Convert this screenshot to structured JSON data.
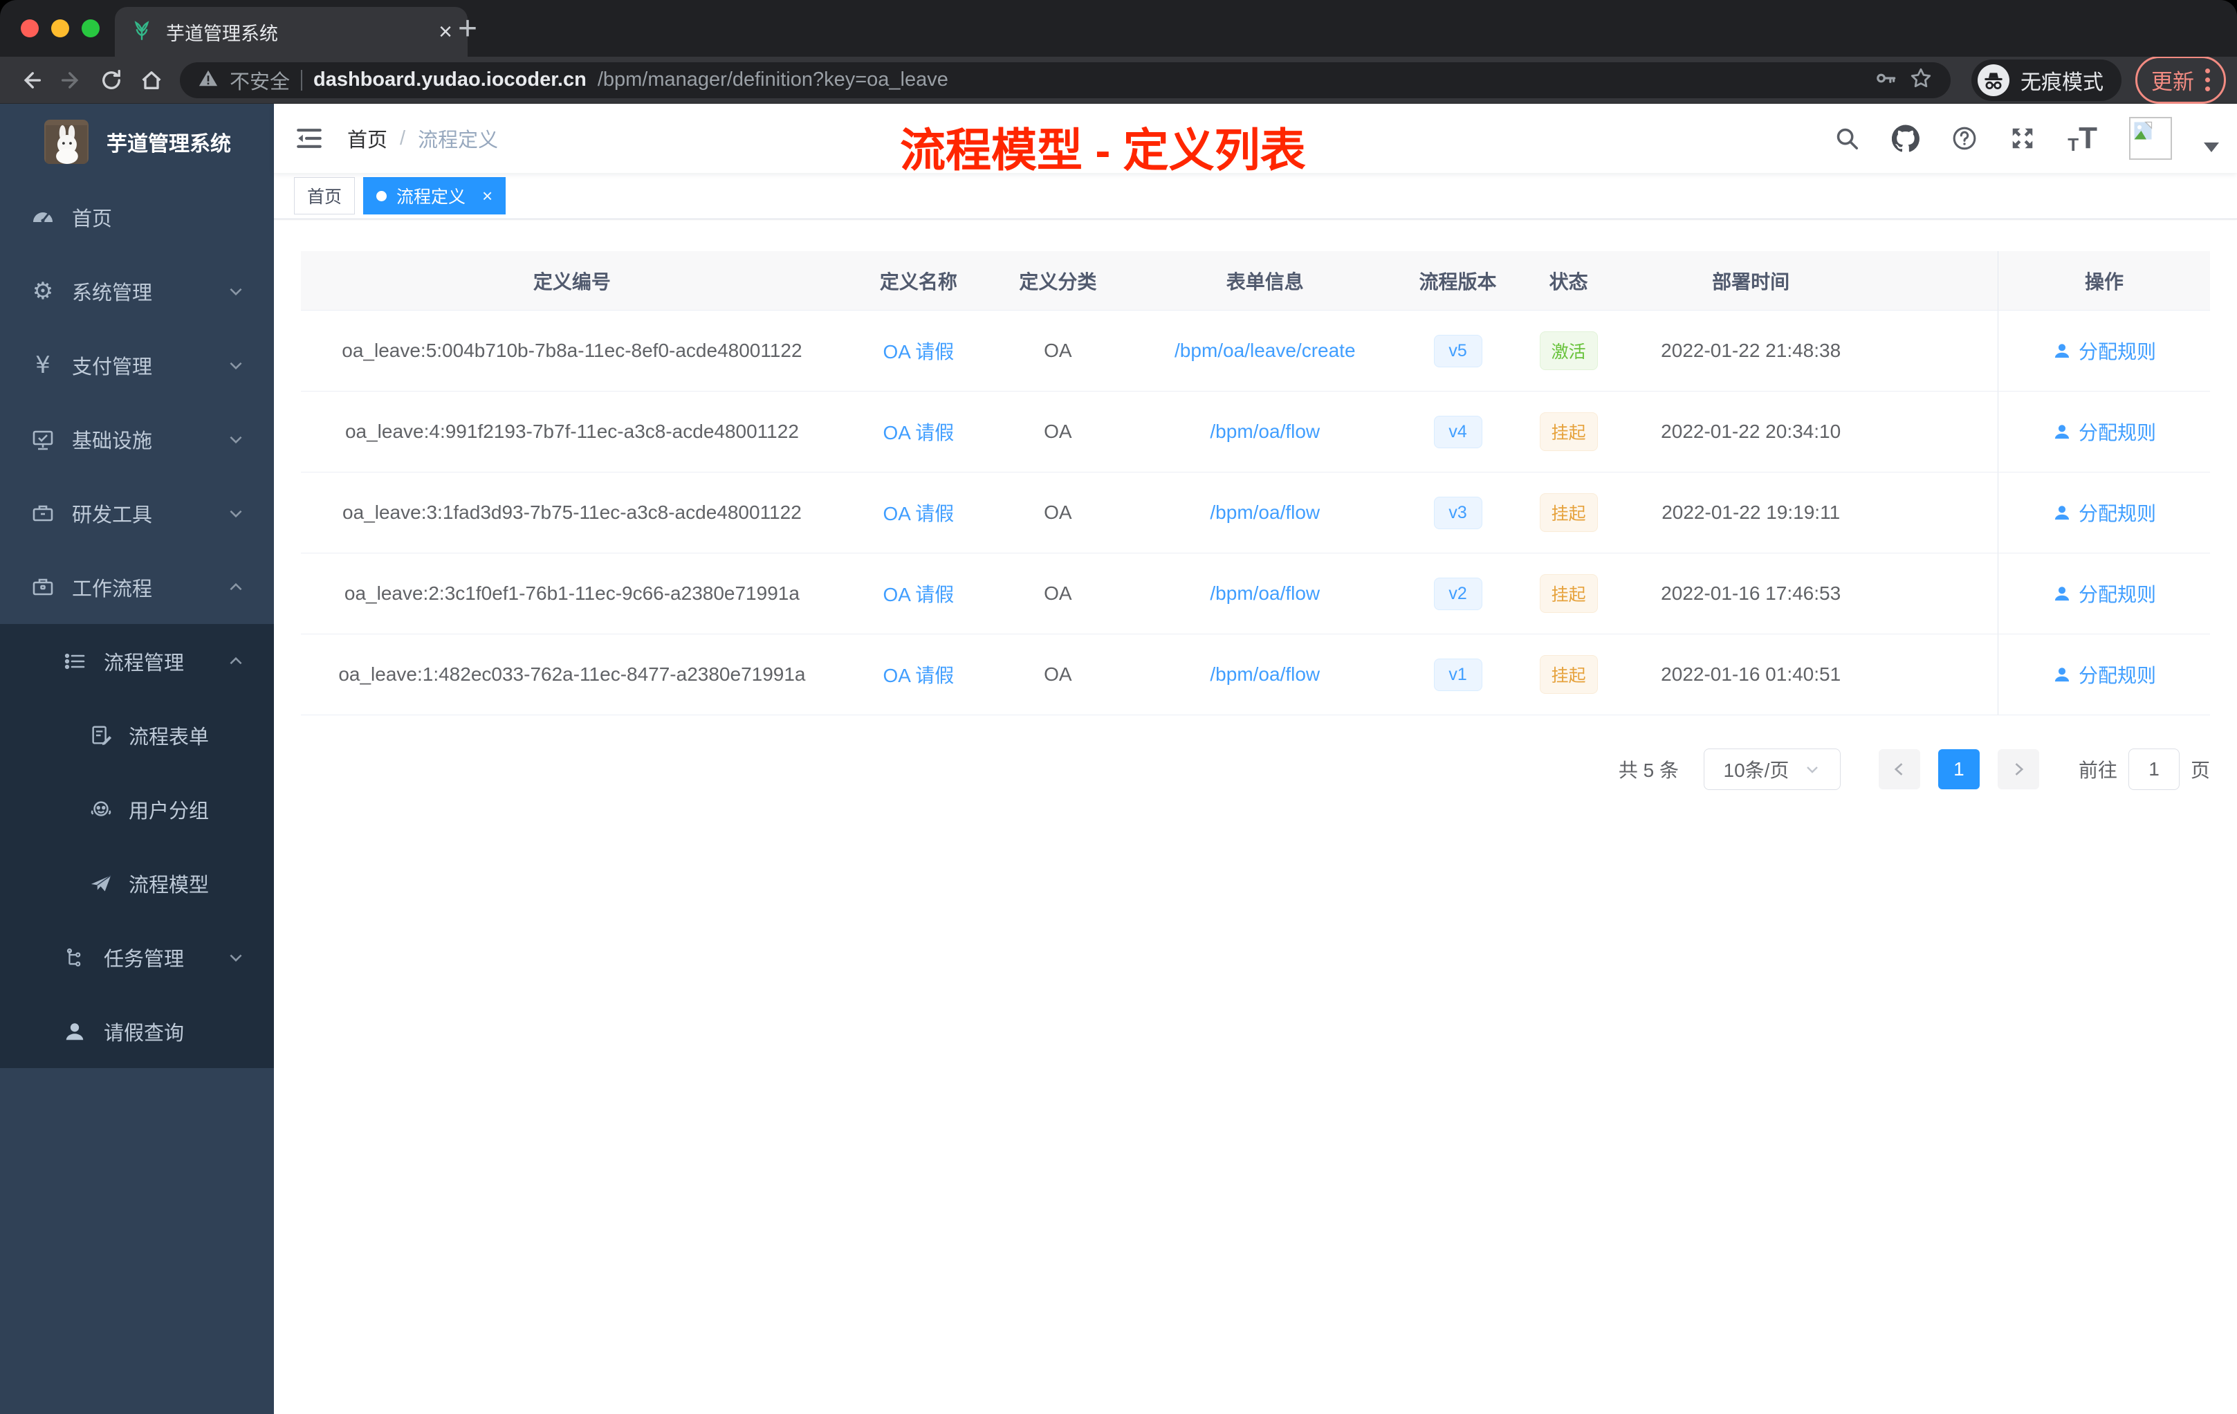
{
  "colors": {
    "accent": "#409eff",
    "success": "#67c23a",
    "warning": "#e6a23c",
    "annotation_red": "#ff2600",
    "sidebar_bg": "#304156",
    "submenu_bg": "#1f2d3d",
    "active_tag_bg": "#2696ff"
  },
  "browser": {
    "tab": {
      "title": "芋道管理系统"
    },
    "address": {
      "security_label": "不安全",
      "host": "dashboard.yudao.iocoder.cn",
      "path": "/bpm/manager/definition?key=oa_leave"
    },
    "incognito_label": "无痕模式",
    "update_label": "更新"
  },
  "sidebar": {
    "logo_title": "芋道管理系统",
    "items": [
      {
        "label": "首页"
      },
      {
        "label": "系统管理"
      },
      {
        "label": "支付管理"
      },
      {
        "label": "基础设施"
      },
      {
        "label": "研发工具"
      },
      {
        "label": "工作流程"
      },
      {
        "label": "流程管理"
      },
      {
        "label": "流程表单"
      },
      {
        "label": "用户分组"
      },
      {
        "label": "流程模型"
      },
      {
        "label": "任务管理"
      },
      {
        "label": "请假查询"
      }
    ]
  },
  "navbar": {
    "breadcrumb": {
      "home": "首页",
      "separator": "/",
      "current": "流程定义"
    },
    "annotation": "流程模型 - 定义列表"
  },
  "tags": {
    "home": "首页",
    "active": "流程定义"
  },
  "table": {
    "columns": [
      "定义编号",
      "定义名称",
      "定义分类",
      "表单信息",
      "流程版本",
      "状态",
      "部署时间",
      "操作"
    ],
    "rows": [
      {
        "id": "oa_leave:5:004b710b-7b8a-11ec-8ef0-acde48001122",
        "name": "OA 请假",
        "category": "OA",
        "form": "/bpm/oa/leave/create",
        "version": "v5",
        "status": "激活",
        "status_type": "success",
        "deployed": "2022-01-22 21:48:38",
        "action": "分配规则"
      },
      {
        "id": "oa_leave:4:991f2193-7b7f-11ec-a3c8-acde48001122",
        "name": "OA 请假",
        "category": "OA",
        "form": "/bpm/oa/flow",
        "version": "v4",
        "status": "挂起",
        "status_type": "warning",
        "deployed": "2022-01-22 20:34:10",
        "action": "分配规则"
      },
      {
        "id": "oa_leave:3:1fad3d93-7b75-11ec-a3c8-acde48001122",
        "name": "OA 请假",
        "category": "OA",
        "form": "/bpm/oa/flow",
        "version": "v3",
        "status": "挂起",
        "status_type": "warning",
        "deployed": "2022-01-22 19:19:11",
        "action": "分配规则"
      },
      {
        "id": "oa_leave:2:3c1f0ef1-76b1-11ec-9c66-a2380e71991a",
        "name": "OA 请假",
        "category": "OA",
        "form": "/bpm/oa/flow",
        "version": "v2",
        "status": "挂起",
        "status_type": "warning",
        "deployed": "2022-01-16 17:46:53",
        "action": "分配规则"
      },
      {
        "id": "oa_leave:1:482ec033-762a-11ec-8477-a2380e71991a",
        "name": "OA 请假",
        "category": "OA",
        "form": "/bpm/oa/flow",
        "version": "v1",
        "status": "挂起",
        "status_type": "warning",
        "deployed": "2022-01-16 01:40:51",
        "action": "分配规则"
      }
    ]
  },
  "pagination": {
    "total": "共 5 条",
    "page_size": "10条/页",
    "current_page": "1",
    "goto_label": "前往",
    "goto_value": "1",
    "unit_label": "页"
  }
}
